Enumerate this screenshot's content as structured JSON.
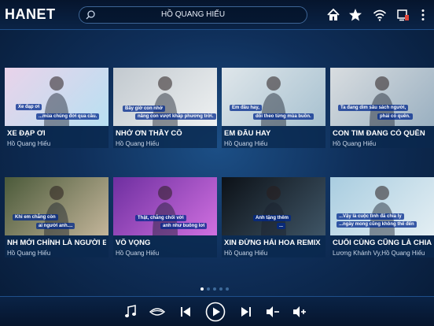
{
  "app": {
    "logo": "HANET"
  },
  "search": {
    "value": "HỒ QUANG HIẾU"
  },
  "topbar_icons": [
    "home-icon",
    "star-icon",
    "wifi-icon",
    "device-screen-icon",
    "more-vertical-icon"
  ],
  "songs": [
    {
      "title": "XE ĐẠP ƠI",
      "artist": "Hồ Quang Hiếu",
      "lyric1": "Xe đạp ơi",
      "lyric2": "...mùa chúng đời qua cầu.",
      "colors": [
        "#e9d3ea",
        "#b8e0f2"
      ]
    },
    {
      "title": "NHỚ ƠN THẦY CÔ",
      "artist": "Hồ Quang Hiếu",
      "lyric1": "Bây giờ con nhớ",
      "lyric2": "nâng con vượt khắp phương trời.",
      "colors": [
        "#c2c9cf",
        "#eef1f2"
      ]
    },
    {
      "title": "EM ĐÂU HAY",
      "artist": "Hồ Quang Hiếu",
      "lyric1": "Em đâu hay,",
      "lyric2": "dõi theo từng mùa buồn.",
      "colors": [
        "#dfe6ea",
        "#a7c1d0"
      ]
    },
    {
      "title": "CON TIM ĐANG CÓ QUÊN",
      "artist": "Hồ Quang Hiếu",
      "lyric1": "Ta đang dìm sâu sách người,",
      "lyric2": "phải có quên.",
      "colors": [
        "#d9dde0",
        "#9ab0c1"
      ]
    },
    {
      "title": "NH MỚI CHÍNH LÀ NGƯỜI EM",
      "artist": "Hồ Quang Hiếu",
      "lyric1": "Khi em chẳng còn",
      "lyric2": "ai người anh....",
      "colors": [
        "#4b5a3a",
        "#c3b59a"
      ]
    },
    {
      "title": "VÔ VỌNG",
      "artist": "Hồ Quang Hiếu",
      "lyric1": "Thật, chẳng chối vời",
      "lyric2": "anh như buông lơi",
      "colors": [
        "#6e2fa0",
        "#d070e0"
      ]
    },
    {
      "title": "XIN ĐỪNG HÁI HOA REMIX",
      "artist": "Hồ Quang Hiếu",
      "lyric1": "Anh tặng thêm",
      "lyric2": "...",
      "colors": [
        "#0c1117",
        "#3f5566"
      ]
    },
    {
      "title": "CUỐI CÙNG CŨNG LÀ CHIA TAY",
      "artist": "Lương Khánh Vy,Hồ Quang Hiếu",
      "lyric1": "...Vậy là cuộc tình đã chia ly",
      "lyric2": "...ngày mong cũng không thể đến",
      "colors": [
        "#a9cde0",
        "#e3eef3"
      ]
    }
  ],
  "pagination": {
    "total": 5,
    "current": 1
  },
  "controls": [
    "music-note-icon",
    "vocal-lips-icon",
    "previous-icon",
    "play-icon",
    "next-icon",
    "volume-down-icon",
    "volume-up-icon"
  ]
}
